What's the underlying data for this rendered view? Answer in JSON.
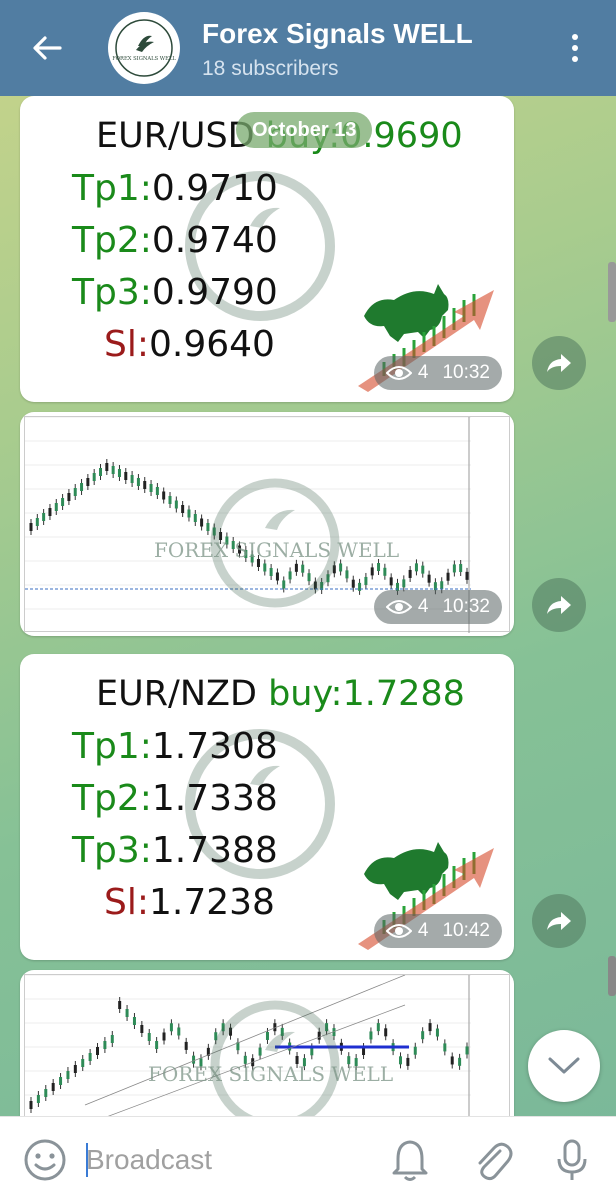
{
  "header": {
    "title": "Forex Signals WELL",
    "subscribers": "18 subscribers",
    "avatar_text": "FOREX SIGNALS WELL"
  },
  "date_separator": "October 13",
  "watermark_text": "FOREX SIGNALS WELL",
  "messages": [
    {
      "pair": "EUR/USD",
      "action": "buy:0.9690",
      "tp1_label": "Tp1:",
      "tp1": "0.9710",
      "tp2_label": "Tp2:",
      "tp2": "0.9740",
      "tp3_label": "Tp3:",
      "tp3": "0.9790",
      "sl_label": "Sl:",
      "sl": "0.9640",
      "views": "4",
      "time": "10:32"
    },
    {
      "type": "chart",
      "views": "4",
      "time": "10:32"
    },
    {
      "pair": "EUR/NZD",
      "action": "buy:1.7288",
      "tp1_label": "Tp1:",
      "tp1": "1.7308",
      "tp2_label": "Tp2:",
      "tp2": "1.7338",
      "tp3_label": "Tp3:",
      "tp3": "1.7388",
      "sl_label": "Sl:",
      "sl": "1.7238",
      "views": "4",
      "time": "10:42"
    },
    {
      "type": "chart"
    }
  ],
  "composer": {
    "placeholder": "Broadcast"
  },
  "icons": {
    "back": "arrow-left-icon",
    "menu": "more-vertical-icon",
    "share": "share-arrow-icon",
    "views": "eye-icon",
    "emoji": "emoji-icon",
    "bell": "bell-icon",
    "attach": "paperclip-icon",
    "mic": "microphone-icon",
    "scroll": "chevron-down-icon"
  },
  "colors": {
    "header": "#517da2",
    "signal_green": "#1a8a1a",
    "signal_red": "#9b1b1b"
  }
}
